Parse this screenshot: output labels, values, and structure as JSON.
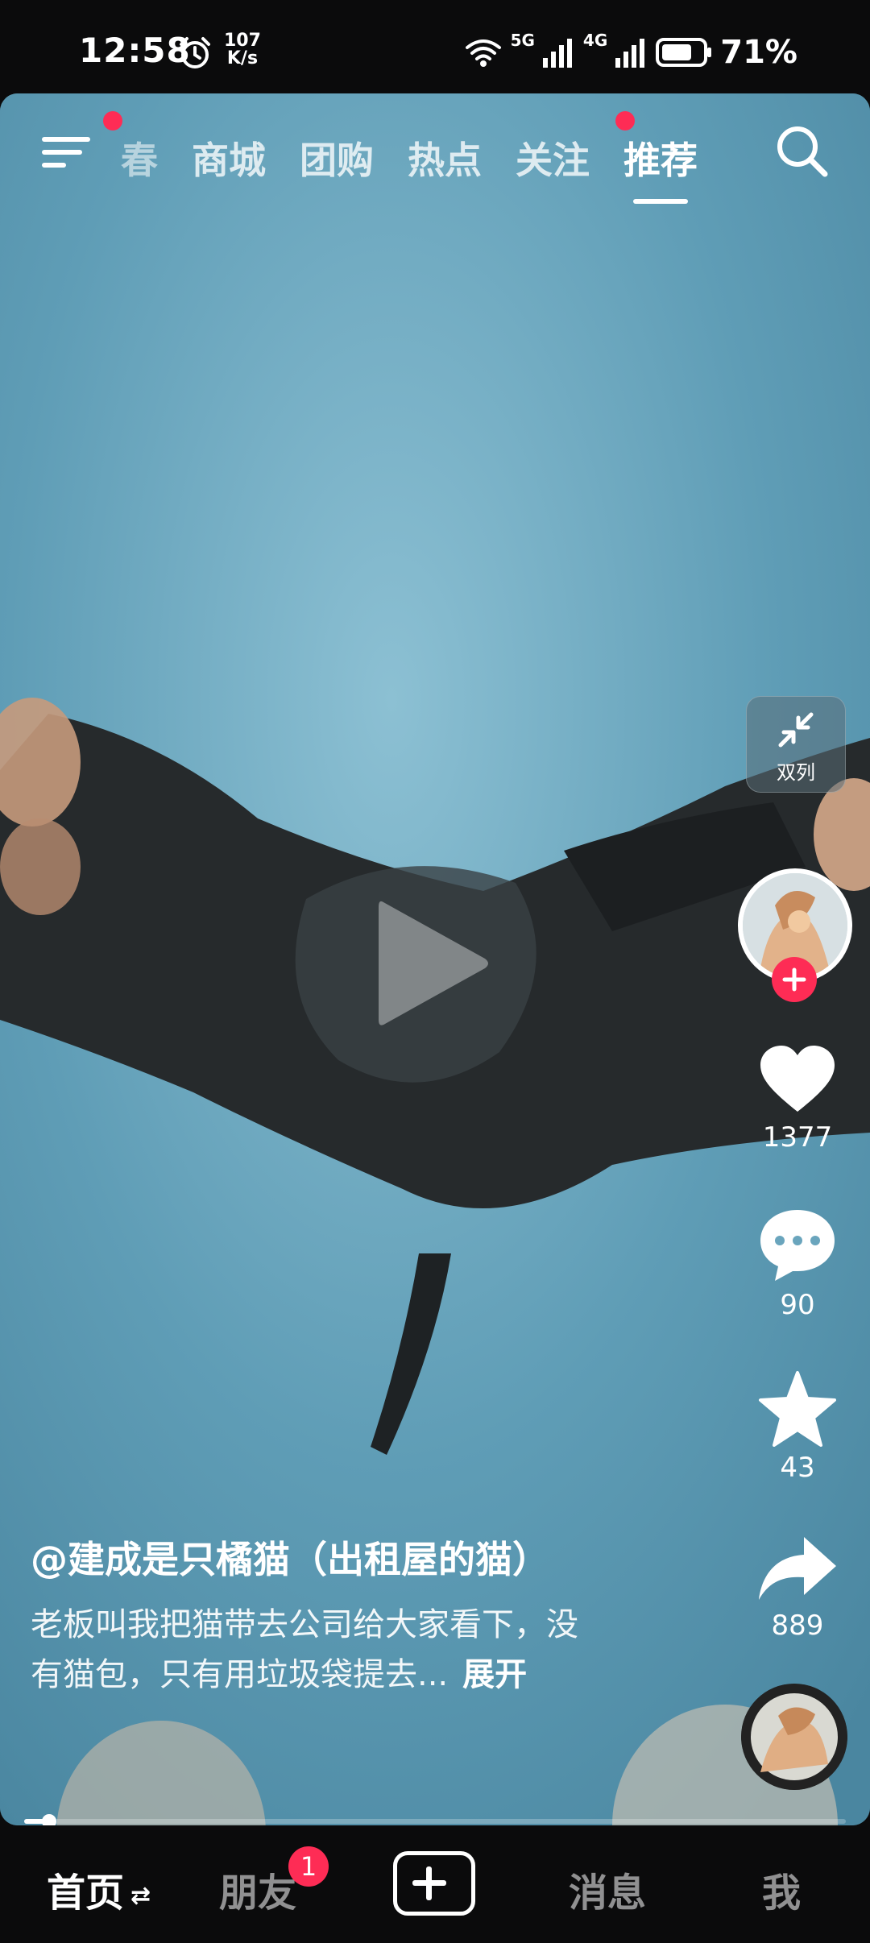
{
  "status_bar": {
    "time": "12:58",
    "net_speed_value": "107",
    "net_speed_unit": "K/s",
    "network_1": "5G",
    "network_2": "4G",
    "battery": "71%",
    "icons": [
      "alarm-icon",
      "wifi-icon",
      "signal-icon",
      "battery-icon"
    ]
  },
  "top_nav": {
    "tabs": [
      {
        "label": "春",
        "active": false
      },
      {
        "label": "商城",
        "active": false
      },
      {
        "label": "团购",
        "active": false
      },
      {
        "label": "热点",
        "active": false
      },
      {
        "label": "关注",
        "active": false,
        "dot": true
      },
      {
        "label": "推荐",
        "active": true
      }
    ],
    "icons": [
      "menu-icon",
      "search-icon"
    ]
  },
  "right_rail": {
    "dual_column_label": "双列",
    "like_count": "1377",
    "comment_count": "90",
    "favorite_count": "43",
    "share_count": "889"
  },
  "caption": {
    "author": "@建成是只橘猫（出租屋的猫）",
    "line1": "老板叫我把猫带去公司给大家看下，没",
    "line2": "有猫包，只有用垃圾袋提去...",
    "expand": "展开"
  },
  "progress": {
    "fraction": 0.03
  },
  "bottom_nav": {
    "home": "首页",
    "friends": "朋友",
    "friends_badge": "1",
    "messages": "消息",
    "me": "我"
  },
  "colors": {
    "accent": "#fe2c55",
    "background": "#0b0b0c",
    "video_bg": "#5e9bb4"
  }
}
